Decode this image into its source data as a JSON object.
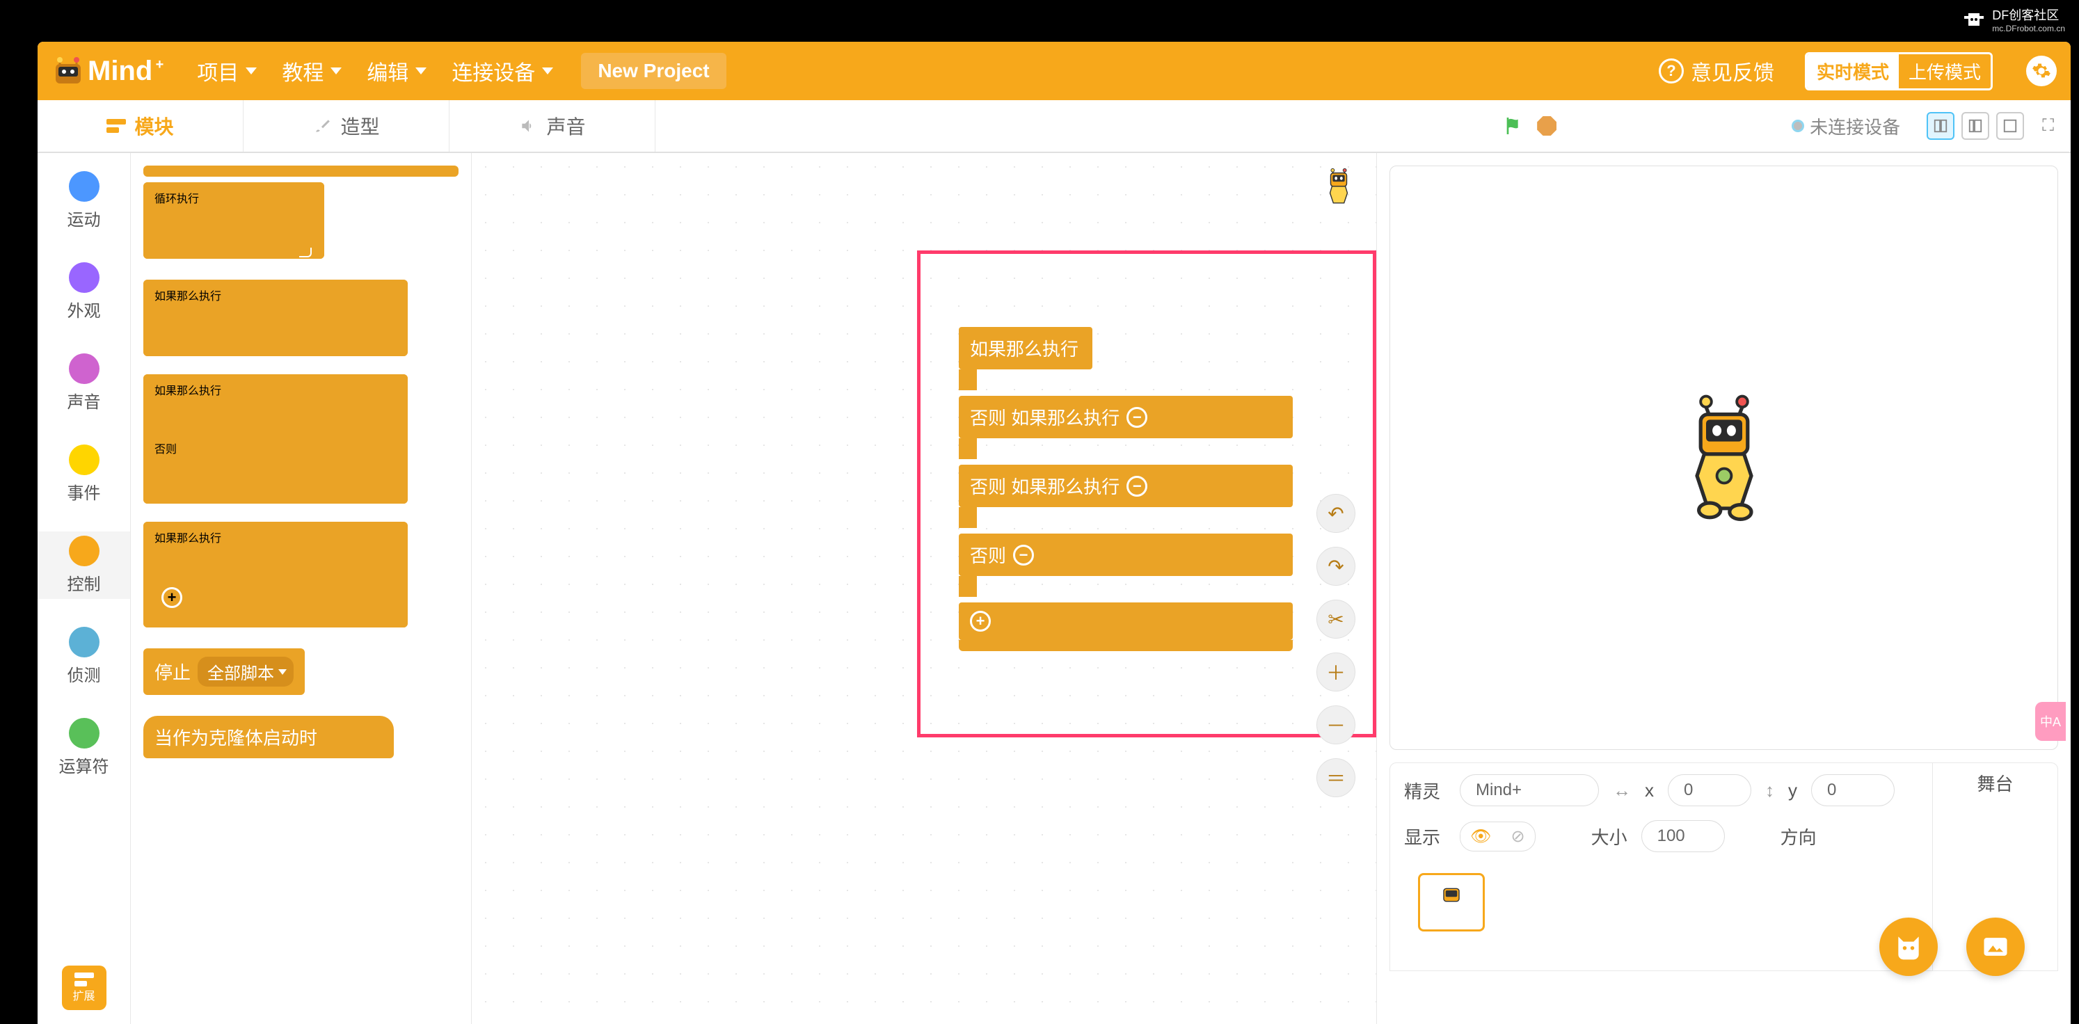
{
  "watermark": {
    "title": "DF创客社区",
    "sub": "mc.DFrobot.com.cn"
  },
  "header": {
    "logo_text": "Mind",
    "logo_sup": "+",
    "menu": {
      "project": "项目",
      "tutorial": "教程",
      "edit": "编辑",
      "connect": "连接设备"
    },
    "project_name": "New Project",
    "feedback": "意见反馈",
    "mode_realtime": "实时模式",
    "mode_upload": "上传模式"
  },
  "tabs": {
    "blocks": "模块",
    "costumes": "造型",
    "sounds": "声音"
  },
  "stagebar": {
    "not_connected": "未连接设备"
  },
  "categories": [
    {
      "label": "运动",
      "color": "#4c97ff"
    },
    {
      "label": "外观",
      "color": "#9966ff"
    },
    {
      "label": "声音",
      "color": "#cf63cf"
    },
    {
      "label": "事件",
      "color": "#ffd500"
    },
    {
      "label": "控制",
      "color": "#f7a81b"
    },
    {
      "label": "侦测",
      "color": "#5cb1d6"
    },
    {
      "label": "运算符",
      "color": "#59c059"
    }
  ],
  "ext_btn": "扩展",
  "palette": {
    "forever": "循环执行",
    "if_then_a": "如果",
    "if_then_b": "那么执行",
    "else": "否则",
    "stop": "停止",
    "stop_opt": "全部脚本",
    "clone_start": "当作为克隆体启动时"
  },
  "script": {
    "r1a": "如果",
    "r1b": "那么执行",
    "r2a": "否则 如果",
    "r2b": "那么执行",
    "r3a": "否则 如果",
    "r3b": "那么执行",
    "r4": "否则"
  },
  "sprite_panel": {
    "sprite_label": "精灵",
    "sprite_name": "Mind+",
    "x_label": "x",
    "x_val": "0",
    "y_label": "y",
    "y_val": "0",
    "show_label": "显示",
    "size_label": "大小",
    "size_val": "100",
    "dir_label": "方向",
    "stage_label": "舞台"
  }
}
